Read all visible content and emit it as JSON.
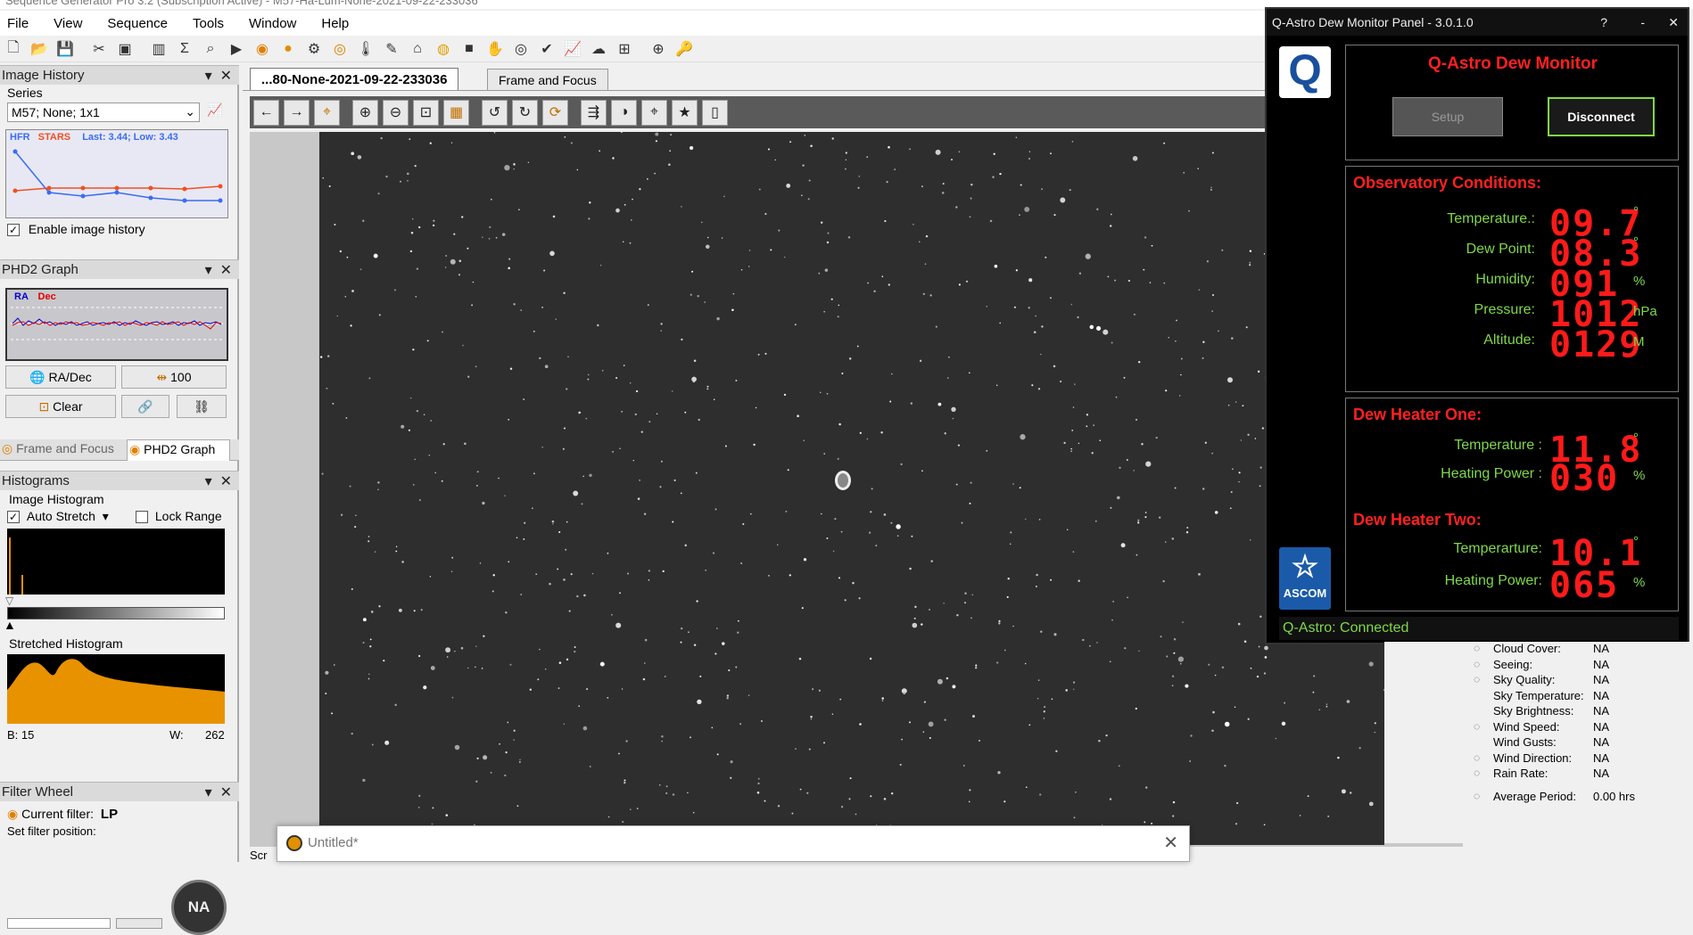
{
  "window_title": "Sequence Generator Pro 3.2  (Subscription Active) - M57-Ha-Lum-None-2021-09-22-233036",
  "menu": [
    "File",
    "View",
    "Sequence",
    "Tools",
    "Window",
    "Help"
  ],
  "image_history": {
    "title": "Image History",
    "series_label": "Series",
    "series_value": "M57; None; 1x1",
    "legend_hfr": "HFR",
    "legend_stars": "STARS",
    "last_low": "Last: 3.44; Low: 3.43",
    "enable_label": "Enable image history",
    "enable_checked": true
  },
  "phd2": {
    "title": "PHD2 Graph",
    "legend_ra": "RA",
    "legend_dec": "Dec",
    "btn_radec": "RA/Dec",
    "btn_100": "100",
    "btn_clear": "Clear"
  },
  "bottom_tabs": [
    "Frame and Focus",
    "PHD2 Graph"
  ],
  "histograms": {
    "title": "Histograms",
    "image_histogram": "Image Histogram",
    "auto_stretch": "Auto Stretch",
    "lock_range": "Lock Range",
    "stretched": "Stretched Histogram",
    "b_label": "B: 15",
    "w_label": "W:",
    "w_value": "262"
  },
  "filter_wheel": {
    "title": "Filter Wheel",
    "current_filter_label": "Current filter:",
    "current_filter_value": "LP",
    "set_position_label": "Set filter position:",
    "badge": "NA"
  },
  "doc_tabs": [
    "...80-None-2021-09-22-233036",
    "Frame and Focus"
  ],
  "dew_monitor": {
    "title": "Q-Astro Dew Monitor Panel - 3.0.1.0",
    "heading": "Q-Astro Dew Monitor",
    "setup": "Setup",
    "disconnect": "Disconnect",
    "obs_title": "Observatory Conditions:",
    "obs_rows": [
      {
        "label": "Temperature.:",
        "value": "09.7",
        "ghost": "8",
        "unit": "°"
      },
      {
        "label": "Dew Point:",
        "value": "08.3",
        "ghost": "8",
        "unit": "°"
      },
      {
        "label": "Humidity:",
        "value": "091",
        "ghost": "",
        "unit": "%"
      },
      {
        "label": "Pressure:",
        "value": "1012",
        "ghost": "",
        "unit": "hPa"
      },
      {
        "label": "Altitude:",
        "value": "0129",
        "ghost": "",
        "unit": "M"
      }
    ],
    "h1_title": "Dew Heater One:",
    "h1_rows": [
      {
        "label": "Temperature :",
        "value": "11.8",
        "ghost": "88",
        "unit": "°"
      },
      {
        "label": "Heating Power :",
        "value": "030",
        "ghost": "",
        "unit": "%"
      }
    ],
    "h2_title": "Dew Heater Two:",
    "h2_rows": [
      {
        "label": "Temperarture:",
        "value": "10.1",
        "ghost": "88",
        "unit": "°"
      },
      {
        "label": "Heating Power:",
        "value": "065",
        "ghost": "",
        "unit": "%"
      }
    ],
    "ascom": "ASCOM",
    "status_label": "Q-Astro:",
    "status_value": "Connected"
  },
  "weather": [
    {
      "label": "Cloud Cover:",
      "value": "NA",
      "icon": "cloud-icon"
    },
    {
      "label": "Seeing:",
      "value": "NA",
      "icon": "eye-icon"
    },
    {
      "label": "Sky Quality:",
      "value": "NA",
      "icon": "sun-icon"
    },
    {
      "label": "Sky Temperature:",
      "value": "NA",
      "icon": ""
    },
    {
      "label": "Sky Brightness:",
      "value": "NA",
      "icon": ""
    },
    {
      "label": "Wind Speed:",
      "value": "NA",
      "icon": "wind-icon"
    },
    {
      "label": "Wind Gusts:",
      "value": "NA",
      "icon": ""
    },
    {
      "label": "Wind Direction:",
      "value": "NA",
      "icon": "compass-icon"
    },
    {
      "label": "Rain Rate:",
      "value": "NA",
      "icon": "umbrella-icon"
    },
    {
      "label": "Average Period:",
      "value": "0.00 hrs",
      "icon": "sigma-icon"
    }
  ],
  "untitled": {
    "title": "Untitled*"
  },
  "bottom_label": "Scr",
  "colors": {
    "accent_red": "#ff2020",
    "accent_green": "#7fd84a",
    "hfr_blue": "#3a6cf0",
    "stars_orange": "#f05020",
    "hist_orange": "#e89200"
  }
}
